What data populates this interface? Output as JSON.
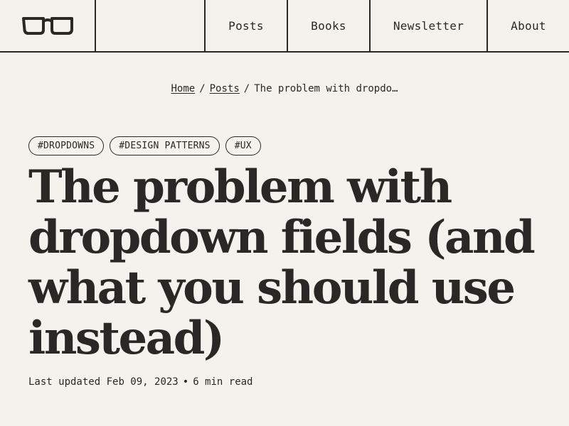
{
  "header": {
    "logo_icon": "glasses-icon",
    "nav": [
      {
        "label": "Posts"
      },
      {
        "label": "Books"
      },
      {
        "label": "Newsletter"
      },
      {
        "label": "About"
      }
    ]
  },
  "breadcrumb": {
    "items": [
      "Home",
      "Posts"
    ],
    "current": "The problem with dropdo…",
    "separator": "/"
  },
  "article": {
    "tags": [
      "#DROPDOWNS",
      "#DESIGN PATTERNS",
      "#UX"
    ],
    "title": "The problem with dropdown fields (and what you should use instead)",
    "updated_label": "Last updated",
    "updated_date": "Feb 09, 2023",
    "separator": "•",
    "read_time": "6 min read"
  },
  "colors": {
    "background": "#f5f2ee",
    "text": "#2a2826"
  }
}
